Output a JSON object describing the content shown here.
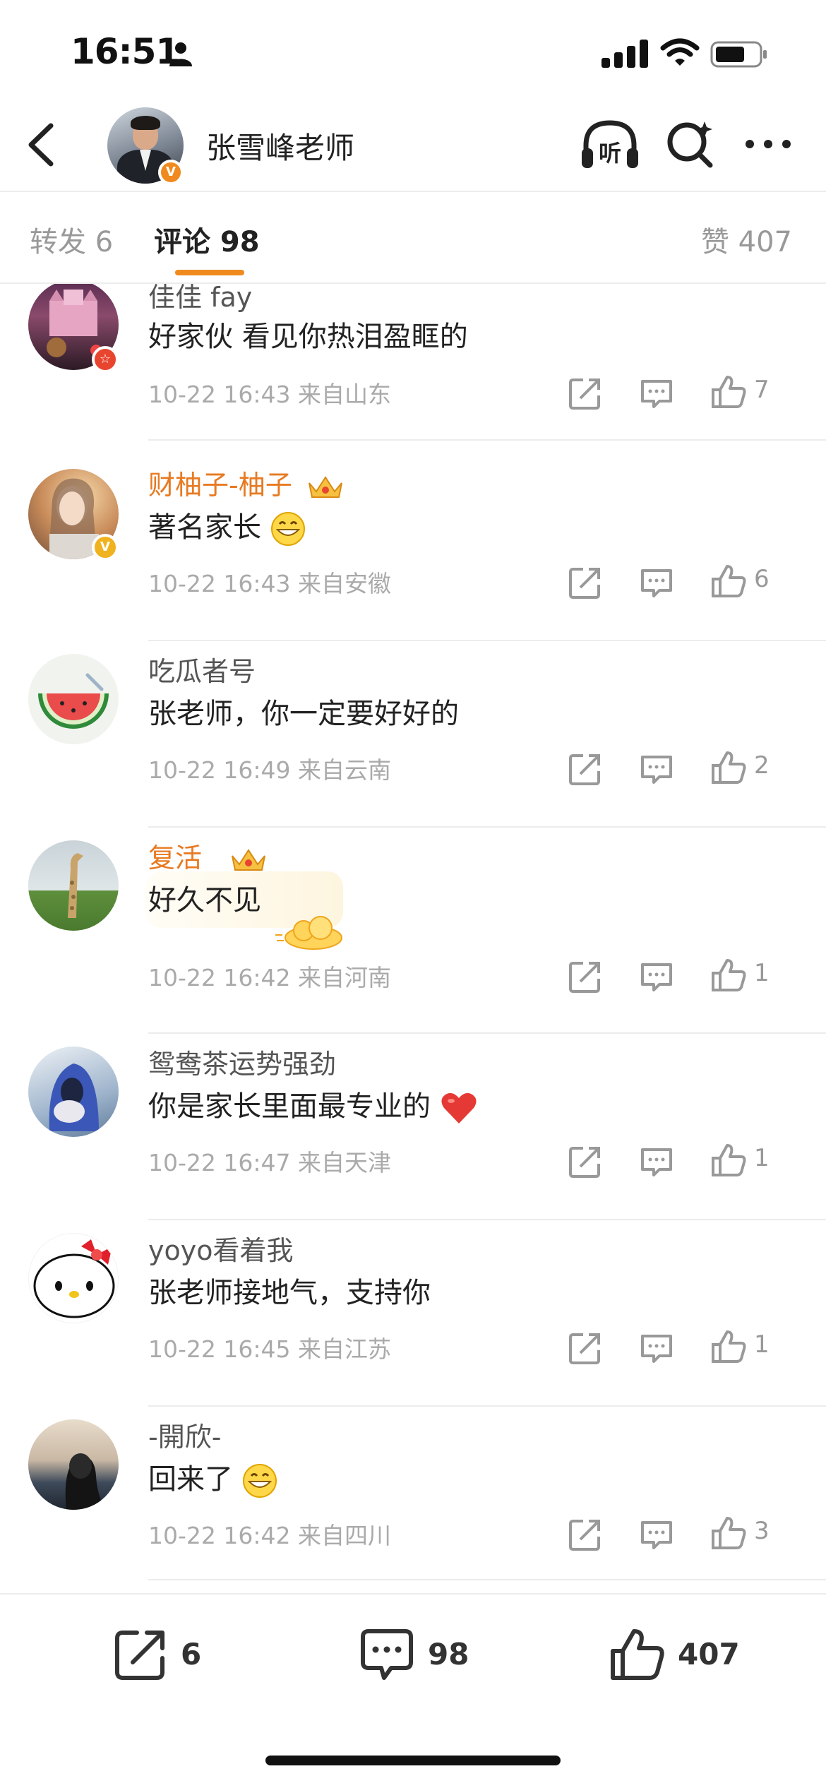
{
  "status": {
    "time": "16:51",
    "icons": [
      "person-icon",
      "signal-icon",
      "wifi-icon",
      "battery-icon"
    ]
  },
  "header": {
    "title": "张雪峰老师",
    "badge": "V",
    "icons": [
      "back-icon",
      "listen-icon",
      "search-icon",
      "more-icon"
    ],
    "listen_glyph": "听"
  },
  "tabs": {
    "repost": "转发 6",
    "comments": "评论 98",
    "likes": "赞 407",
    "active_color": "#f08a1e"
  },
  "comments": [
    {
      "name": "佳佳 fay",
      "name_color": "#555555",
      "text": "好家伙 看见你热泪盈眶的",
      "time": "10-22 16:43",
      "location": "来自山东",
      "likes": "7",
      "badge": "red-star"
    },
    {
      "name": "财柚子-柚子",
      "name_color": "#e77a22",
      "text": "著名家长",
      "emoji": "grin-emoji",
      "time": "10-22 16:43",
      "location": "来自安徽",
      "likes": "6",
      "badge": "V",
      "crown": true
    },
    {
      "name": "吃瓜者号",
      "name_color": "#555555",
      "text": "张老师，你一定要好好的",
      "time": "10-22 16:49",
      "location": "来自云南",
      "likes": "2"
    },
    {
      "name": "复活_",
      "name_color": "#e77a22",
      "text": "好久不见",
      "time": "10-22 16:42",
      "location": "来自河南",
      "likes": "1",
      "crown": true,
      "sticker": "cloud-sticker"
    },
    {
      "name": "鸳鸯茶运势强劲",
      "name_color": "#555555",
      "text": "你是家长里面最专业的",
      "emoji": "heart-emoji",
      "time": "10-22 16:47",
      "location": "来自天津",
      "likes": "1"
    },
    {
      "name": "yoyo看着我",
      "name_color": "#555555",
      "text": "张老师接地气，支持你",
      "time": "10-22 16:45",
      "location": "来自江苏",
      "likes": "1"
    },
    {
      "name": "-開欣-",
      "name_color": "#555555",
      "text": "回来了",
      "emoji": "grin-emoji",
      "time": "10-22 16:42",
      "location": "来自四川",
      "likes": "3"
    }
  ],
  "bottom_bar": {
    "repost_count": "6",
    "comment_count": "98",
    "like_count": "407"
  }
}
